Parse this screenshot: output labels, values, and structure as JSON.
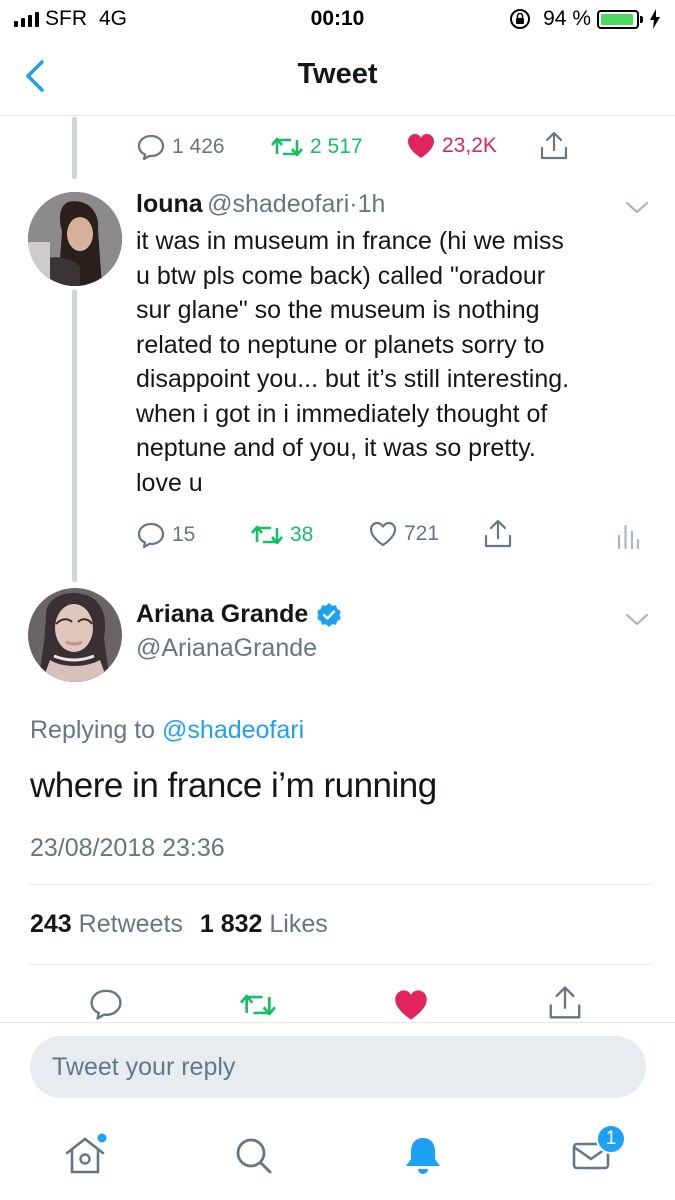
{
  "status_bar": {
    "carrier": "SFR",
    "network": "4G",
    "time": "00:10",
    "battery": "94 %",
    "battery_level": 0.94
  },
  "nav": {
    "title": "Tweet"
  },
  "parent_tweet_actions": {
    "replies": "1 426",
    "retweets": "2 517",
    "likes": "23,2K"
  },
  "tweet_louna": {
    "name": "louna",
    "handle": "@shadeofari",
    "separator": "·",
    "time": "1h",
    "text_lines": [
      "it was in museum in france (hi we miss",
      "u btw pls come back) called \"oradour",
      "sur glane\" so the museum is nothing",
      "related to neptune or planets sorry to",
      "disappoint you... but it’s still interesting.",
      "when i got in i immediately thought of",
      "neptune and of you, it was so pretty.",
      "love u"
    ],
    "replies": "15",
    "retweets": "38",
    "likes": "721"
  },
  "main_tweet": {
    "name": "Ariana Grande",
    "handle": "@ArianaGrande",
    "replying_prefix": "Replying to",
    "replying_to": "@shadeofari",
    "text": "where in france i’m running",
    "timestamp": "23/08/2018 23:36",
    "retweet_count": "243",
    "retweet_label": "Retweets",
    "like_count": "1 832",
    "like_label": "Likes"
  },
  "reply": {
    "placeholder": "Tweet your reply"
  },
  "tab_bar": {
    "messages_badge": "1"
  },
  "colors": {
    "accent": "#1da1f2",
    "retweet_green": "#17bf63",
    "like_red": "#e0245e",
    "muted": "#657786"
  }
}
